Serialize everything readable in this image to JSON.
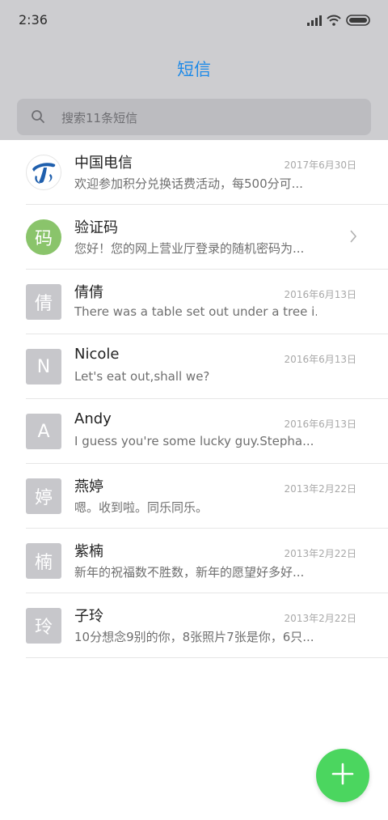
{
  "status_bar": {
    "time": "2:36"
  },
  "header": {
    "title": "短信"
  },
  "search": {
    "placeholder": "搜索11条短信"
  },
  "conversations": [
    {
      "name": "中国电信",
      "date": "2017年6月30日",
      "preview": "欢迎参加积分兑换话费活动，每500分可...",
      "avatar": "",
      "avatar_icon": "china-telecom-logo-icon"
    },
    {
      "name": "验证码",
      "date": "",
      "preview": "您好！您的网上营业厅登录的随机密码为...",
      "avatar": "码",
      "has_chevron": true
    },
    {
      "name": "倩倩",
      "date": "2016年6月13日",
      "preview": "There was a table set out under a tree i...",
      "avatar": "倩"
    },
    {
      "name": "Nicole",
      "date": "2016年6月13日",
      "preview": "Let's eat out,shall we?",
      "avatar": "N"
    },
    {
      "name": "Andy",
      "date": "2016年6月13日",
      "preview": "I guess you're some lucky guy.Stepha...",
      "avatar": "A"
    },
    {
      "name": "燕婷",
      "date": "2013年2月22日",
      "preview": "嗯。收到啦。同乐同乐。",
      "avatar": "婷"
    },
    {
      "name": "紫楠",
      "date": "2013年2月22日",
      "preview": "新年的祝福数不胜数，新年的愿望好多好...",
      "avatar": "楠"
    },
    {
      "name": "子玲",
      "date": "2013年2月22日",
      "preview": "10分想念9别的你，8张照片7张是你，6只...",
      "avatar": "玲"
    }
  ],
  "colors": {
    "accent": "#1e8ae8",
    "fab": "#4bd65f",
    "header_bg": "#cdcdd0"
  },
  "icons": {
    "search": "search-icon",
    "fab": "plus-icon",
    "chevron": "chevron-right-icon"
  }
}
